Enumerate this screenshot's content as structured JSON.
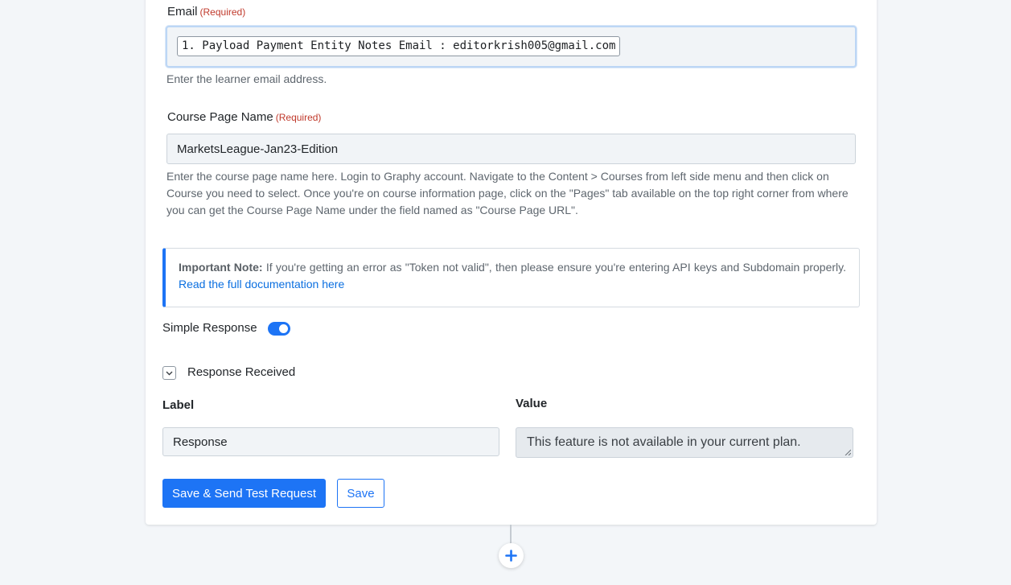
{
  "email": {
    "label": "Email",
    "required": "(Required)",
    "value": "1. Payload Payment Entity Notes Email : editorkrish005@gmail.com",
    "help": "Enter the learner email address."
  },
  "course": {
    "label": "Course Page Name",
    "required": "(Required)",
    "value": "MarketsLeague-Jan23-Edition",
    "help": "Enter the course page name here. Login to Graphy account. Navigate to the Content > Courses from left side menu and then click on Course you need to select. Once you're on course information page, click on the \"Pages\" tab available on the top right corner from where you can get the Course Page Name under the field named as \"Course Page URL\"."
  },
  "note": {
    "title": "Important Note:",
    "text": " If you're getting an error as \"Token not valid\", then please ensure you're entering API keys and Subdomain properly.",
    "link": "Read the full documentation here"
  },
  "simple_response": {
    "label": "Simple Response",
    "enabled": true
  },
  "response_received": {
    "label": "Response Received",
    "label_header": "Label",
    "value_header": "Value",
    "row_label": "Response",
    "row_value": "This feature is not available in your current plan."
  },
  "buttons": {
    "save_send": "Save & Send Test Request",
    "save": "Save"
  },
  "icons": {
    "chevron": "chevron-down-icon",
    "add": "plus-icon",
    "resize": "resize-handle-icon"
  },
  "colors": {
    "accent": "#1d74f5",
    "required": "#c0392b",
    "background": "#f3f6f9"
  }
}
